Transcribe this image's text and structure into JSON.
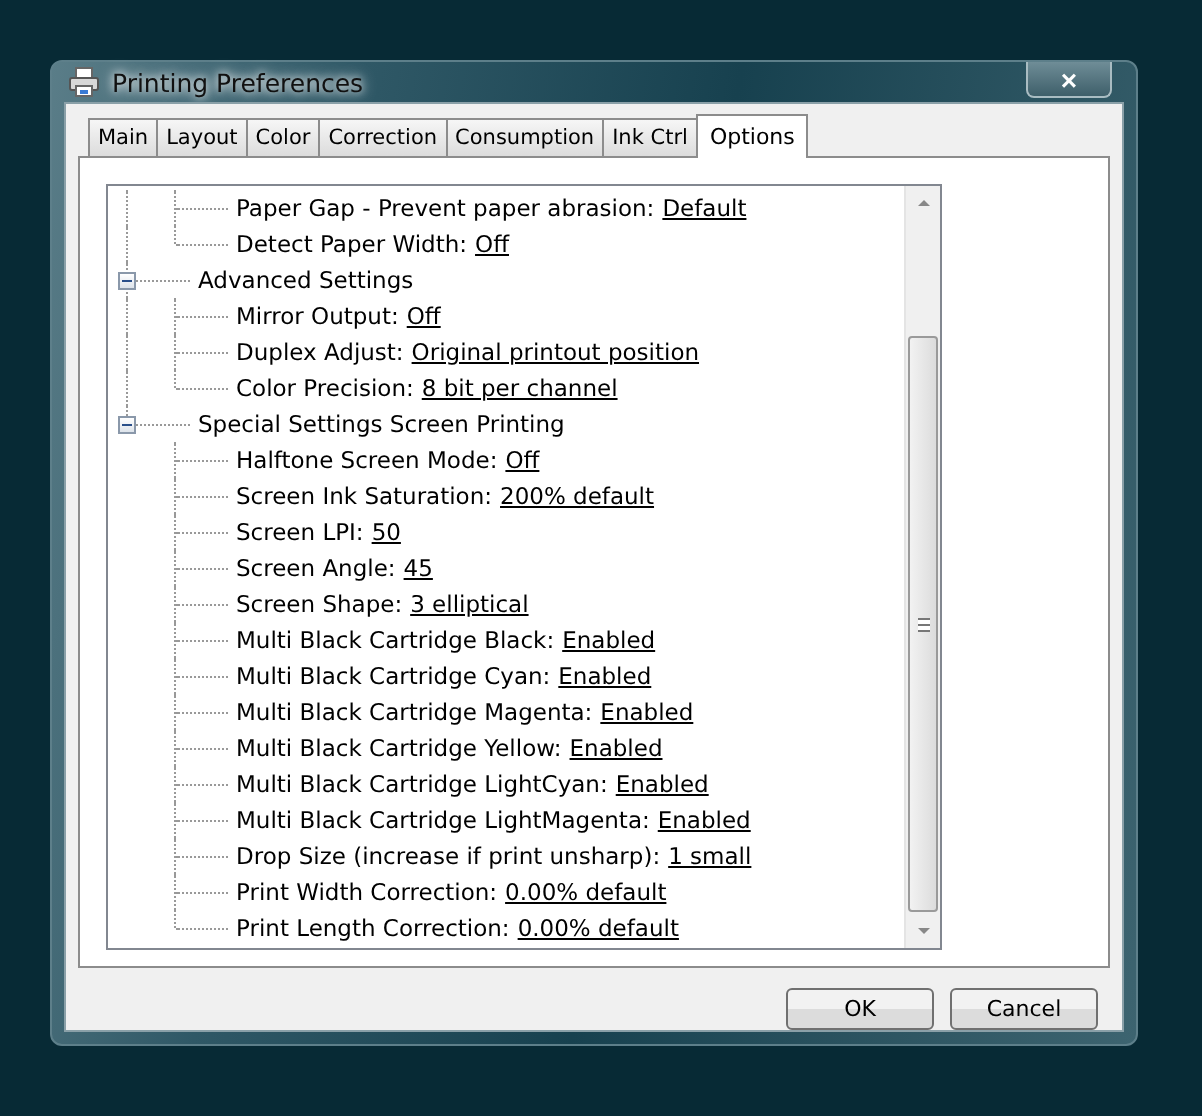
{
  "window": {
    "title": "Printing Preferences",
    "close": "×"
  },
  "tabs": [
    {
      "label": "Main",
      "selected": false
    },
    {
      "label": "Layout",
      "selected": false
    },
    {
      "label": "Color",
      "selected": false
    },
    {
      "label": "Correction",
      "selected": false
    },
    {
      "label": "Consumption",
      "selected": false
    },
    {
      "label": "Ink Ctrl",
      "selected": false
    },
    {
      "label": "Options",
      "selected": true
    }
  ],
  "tree": {
    "continued_children": [
      {
        "label": "Paper Gap - Prevent paper abrasion:",
        "value": "Default"
      },
      {
        "label": "Detect Paper Width:",
        "value": "Off"
      }
    ],
    "groups": [
      {
        "label": "Advanced Settings",
        "expanded": true,
        "children": [
          {
            "label": "Mirror Output:",
            "value": "Off"
          },
          {
            "label": "Duplex Adjust:",
            "value": "Original printout position"
          },
          {
            "label": "Color Precision:",
            "value": "8 bit per channel"
          }
        ]
      },
      {
        "label": "Special Settings Screen Printing",
        "expanded": true,
        "children": [
          {
            "label": "Halftone Screen Mode:",
            "value": "Off"
          },
          {
            "label": "Screen Ink Saturation:",
            "value": "200% default"
          },
          {
            "label": "Screen LPI:",
            "value": "50"
          },
          {
            "label": "Screen Angle:",
            "value": "45"
          },
          {
            "label": "Screen Shape:",
            "value": "3 elliptical"
          },
          {
            "label": "Multi Black Cartridge Black:",
            "value": "Enabled"
          },
          {
            "label": "Multi Black Cartridge Cyan:",
            "value": "Enabled"
          },
          {
            "label": "Multi Black Cartridge Magenta:",
            "value": "Enabled"
          },
          {
            "label": "Multi Black Cartridge Yellow:",
            "value": "Enabled"
          },
          {
            "label": "Multi Black Cartridge LightCyan:",
            "value": "Enabled"
          },
          {
            "label": "Multi Black Cartridge LightMagenta:",
            "value": "Enabled"
          },
          {
            "label": "Drop Size (increase if print unsharp):",
            "value": "1 small"
          },
          {
            "label": "Print Width Correction:",
            "value": "0.00% default"
          },
          {
            "label": "Print Length Correction:",
            "value": "0.00% default"
          }
        ]
      }
    ]
  },
  "buttons": [
    {
      "label": "OK"
    },
    {
      "label": "Cancel"
    }
  ]
}
